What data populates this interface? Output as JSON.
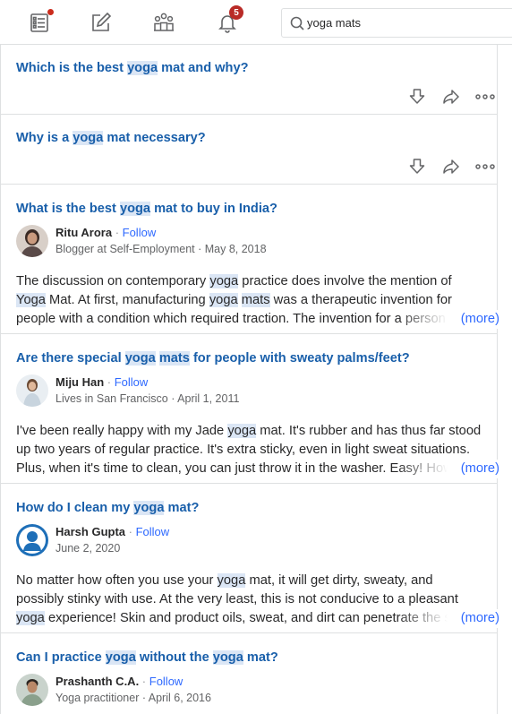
{
  "nav": {
    "icons": [
      "home-feed-icon",
      "write-answer-icon",
      "spaces-icon",
      "notifications-icon"
    ],
    "notifications_count": "5"
  },
  "search": {
    "value": "yoga mats"
  },
  "questions": [
    {
      "title": [
        "Which is the best ",
        "yoga",
        " mat and why?"
      ]
    },
    {
      "title": [
        "Why is a ",
        "yoga",
        " mat necessary?"
      ]
    }
  ],
  "answers": [
    {
      "title": [
        "What is the best ",
        "yoga",
        " mat to buy in India?"
      ],
      "name": "Ritu Arora",
      "follow": "Follow",
      "dot": " · ",
      "meta": "Blogger at Self-Employment · May 8, 2018",
      "lines": [
        [
          "The discussion on contemporary ",
          "yoga",
          " practice does involve the mention of"
        ],
        [
          "Yoga",
          " Mat. At first, manufacturing ",
          "yoga",
          " ",
          "mats",
          " was a therapeutic invention for"
        ],
        [
          "people with a condition which required traction. The invention for a person"
        ]
      ],
      "more": "(more)"
    },
    {
      "title": [
        "Are there special ",
        "yoga",
        " ",
        "mats",
        " for people with sweaty palms/feet?"
      ],
      "name": "Miju Han",
      "follow": "Follow",
      "dot": " · ",
      "meta": "Lives in San Francisco · April 1, 2011",
      "lines": [
        [
          "I've been really happy with my Jade ",
          "yoga",
          " mat. It's rubber and has thus far stood"
        ],
        [
          "up two years of regular practice. It's extra sticky, even in light sweat situations."
        ],
        [
          "Plus, when it's time to clean, you can just throw it in the washer. Easy! How"
        ]
      ],
      "more": "(more)"
    },
    {
      "title": [
        "How do I clean my ",
        "yoga",
        " mat?"
      ],
      "name": "Harsh Gupta",
      "follow": "Follow",
      "dot": " · ",
      "meta": "June 2, 2020",
      "lines": [
        [
          "No matter how often you use your ",
          "yoga",
          " mat, it will get dirty, sweaty, and"
        ],
        [
          "possibly stinky with use. At the very least, this is not conducive to a pleasant"
        ],
        [
          "yoga",
          " experience! Skin and product oils, sweat, and dirt can penetrate the s"
        ]
      ],
      "more": "(more)"
    },
    {
      "title": [
        "Can I practice ",
        "yoga",
        " without the ",
        "yoga",
        " mat?"
      ],
      "name": "Prashanth C.A.",
      "follow": "Follow",
      "dot": " · ",
      "meta": "Yoga practitioner · April 6, 2016"
    }
  ]
}
